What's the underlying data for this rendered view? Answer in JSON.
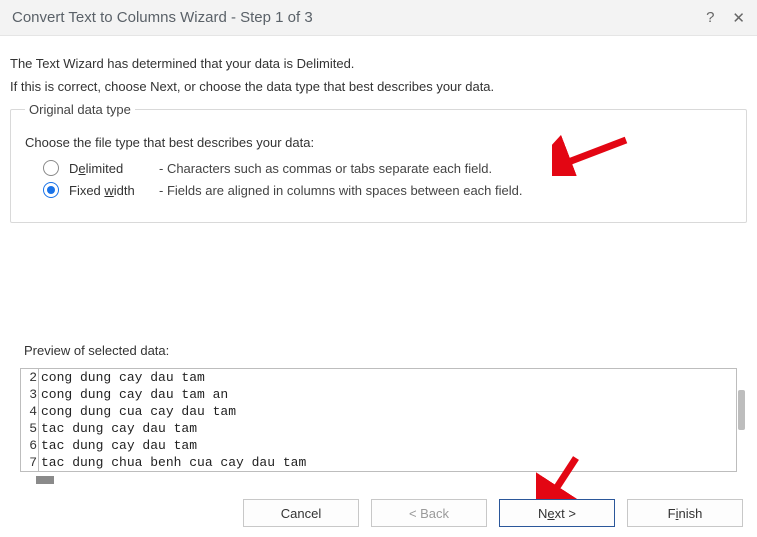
{
  "title": "Convert Text to Columns Wizard - Step 1 of 3",
  "intro1": "The Text Wizard has determined that your data is Delimited.",
  "intro2": "If this is correct, choose Next, or choose the data type that best describes your data.",
  "group": {
    "legend": "Original data type",
    "choose": "Choose the file type that best describes your data:",
    "options": [
      {
        "label_pre": "D",
        "label_under": "e",
        "label_post": "limited",
        "desc": "- Characters such as commas or tabs separate each field.",
        "selected": false
      },
      {
        "label_pre": "Fixed ",
        "label_under": "w",
        "label_post": "idth",
        "desc": "- Fields are aligned in columns with spaces between each field.",
        "selected": true
      }
    ]
  },
  "preview": {
    "label": "Preview of selected data:",
    "rows": [
      {
        "num": "2",
        "text": "cong dung cay dau tam"
      },
      {
        "num": "3",
        "text": "cong dung cay dau tam an"
      },
      {
        "num": "4",
        "text": "cong dung cua cay dau tam"
      },
      {
        "num": "5",
        "text": "tac dung cay dau tam"
      },
      {
        "num": "6",
        "text": "tac dung cay dau tam"
      },
      {
        "num": "7",
        "text": "tac dung chua benh cua cay dau tam"
      }
    ]
  },
  "buttons": {
    "cancel": "Cancel",
    "back": "< Back",
    "next_pre": "N",
    "next_under": "e",
    "next_post": "xt >",
    "finish_pre": "F",
    "finish_under": "i",
    "finish_post": "nish"
  }
}
